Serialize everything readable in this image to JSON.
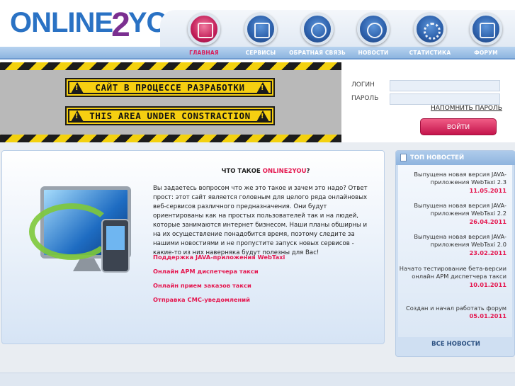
{
  "logo": {
    "part1": "ONLINE",
    "part2": "2",
    "part3": "YOU"
  },
  "nav": [
    {
      "label": "ГЛАВНАЯ",
      "icon": "home-icon",
      "active": true
    },
    {
      "label": "СЕРВИСЫ",
      "icon": "services-icon",
      "active": false
    },
    {
      "label": "ОБРАТНАЯ СВЯЗЬ",
      "icon": "chat-icon",
      "active": false
    },
    {
      "label": "НОВОСТИ",
      "icon": "news-icon",
      "active": false
    },
    {
      "label": "СТАТИСТИКА",
      "icon": "stats-icon",
      "active": false
    },
    {
      "label": "ФОРУМ",
      "icon": "forum-icon",
      "active": false
    }
  ],
  "banner": {
    "line1": "САЙТ В ПРОЦЕССЕ РАЗРАБОТКИ",
    "line2": "THIS AREA UNDER CONSTRACTION"
  },
  "login": {
    "login_label": "ЛОГИН",
    "password_label": "ПАРОЛЬ",
    "remind_label": "НАПОМНИТЬ ПАРОЛЬ",
    "submit_label": "ВОЙТИ"
  },
  "main": {
    "title_prefix": "ЧТО ТАКОЕ ",
    "title_brand": "ONLINE2YOU",
    "title_suffix": "?",
    "text": "Вы задаетесь вопросом что же это такое и зачем это надо? Ответ прост: этот сайт является головным для целого ряда онлайновых веб-сервисов различного предназначения. Они будут ориентированы как на простых пользователей так и на людей, которые занимаются интернет бизнесом. Наши планы обширны и на их осуществление понадобится время, поэтому следите за нашими новостиями и не пропустите запуск новых сервисов - какие-то из них наверняка будут полезны для Вас!",
    "links": [
      "Поддержка JAVA-приложения WebTaxi",
      "Онлайн АРМ диспетчера такси",
      "Онлайн прием заказов такси",
      "Отправка СМС-уведомлений"
    ]
  },
  "news": {
    "title": "ТОП НОВОСТЕЙ",
    "items": [
      {
        "text": "Выпущена новая версия JAVA-приложения WebTaxi 2.3",
        "date": "11.05.2011"
      },
      {
        "text": "Выпущена новая версия JAVA-приложения WebTaxi 2.2",
        "date": "26.04.2011"
      },
      {
        "text": "Выпущена новая версия JAVA-приложения WebTaxi 2.0",
        "date": "23.02.2011"
      },
      {
        "text": "Начато тестирование бета-версии онлайн АРМ диспетчера такси",
        "date": "10.01.2011"
      },
      {
        "text": "Создан и начал работать форум",
        "date": "05.01.2011"
      }
    ],
    "all_label": "ВСЕ НОВОСТИ"
  },
  "colors": {
    "accent": "#e4174f",
    "brand_blue": "#2a72c4",
    "nav_bar": "#8eb5e0"
  }
}
